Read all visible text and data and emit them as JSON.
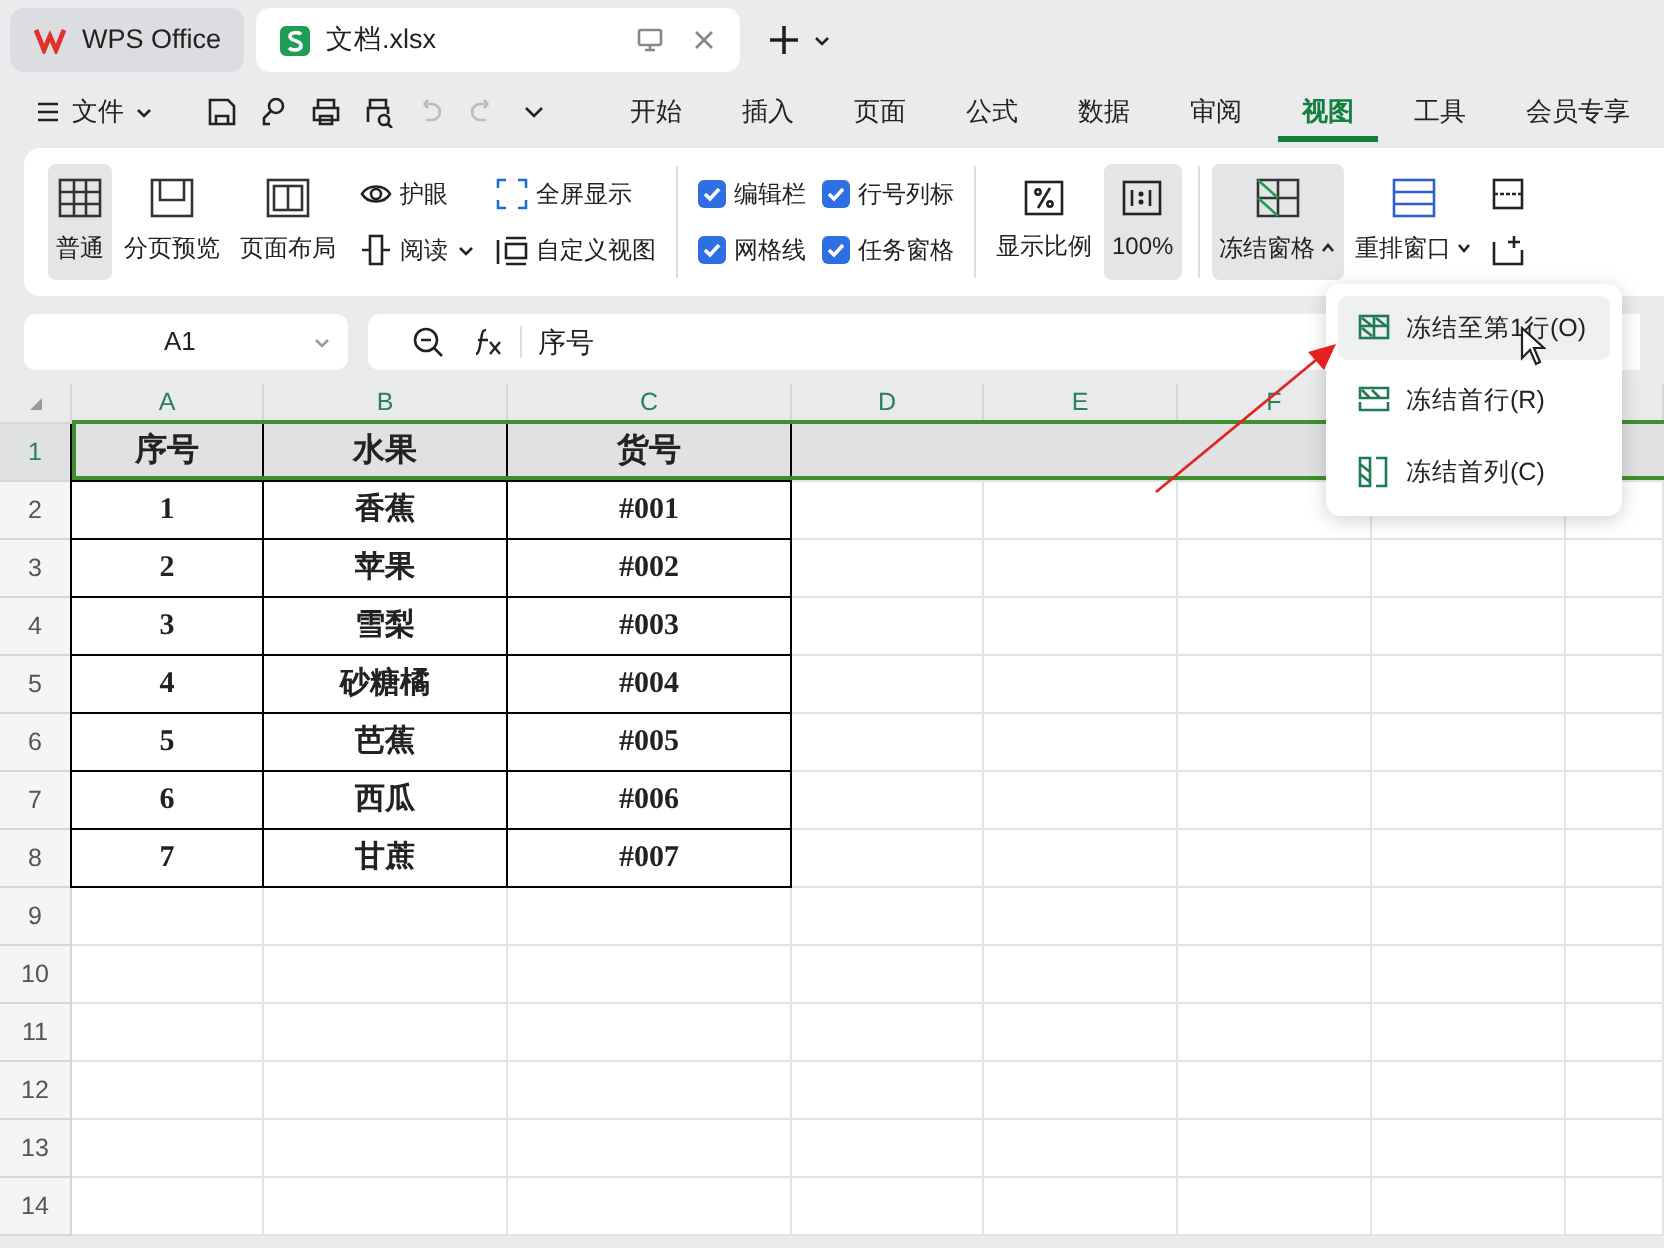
{
  "tabs": [
    {
      "label": "WPS Office",
      "selected": false
    },
    {
      "label": "文档.xlsx",
      "selected": true
    }
  ],
  "file_menu": "文件",
  "menu_tabs": [
    {
      "label": "开始",
      "selected": false
    },
    {
      "label": "插入",
      "selected": false
    },
    {
      "label": "页面",
      "selected": false
    },
    {
      "label": "公式",
      "selected": false
    },
    {
      "label": "数据",
      "selected": false
    },
    {
      "label": "审阅",
      "selected": false
    },
    {
      "label": "视图",
      "selected": true
    },
    {
      "label": "工具",
      "selected": false
    },
    {
      "label": "会员专享",
      "selected": false
    }
  ],
  "ribbon": {
    "view_buttons": [
      {
        "label": "普通",
        "selected": true
      },
      {
        "label": "分页预览",
        "selected": false
      },
      {
        "label": "页面布局",
        "selected": false
      }
    ],
    "small_buttons": [
      "护眼",
      "阅读",
      "全屏显示",
      "自定义视图"
    ],
    "checkboxes": [
      {
        "label": "编辑栏",
        "checked": true
      },
      {
        "label": "网格线",
        "checked": true
      },
      {
        "label": "行号列标",
        "checked": true
      },
      {
        "label": "任务窗格",
        "checked": true
      }
    ],
    "zoom_buttons": [
      {
        "label": "显示比例",
        "selected": false
      },
      {
        "label": "100%",
        "selected": true
      }
    ],
    "window_buttons": [
      {
        "label": "冻结窗格",
        "expanded": true
      },
      {
        "label": "重排窗口",
        "expanded": false
      }
    ]
  },
  "name_box": "A1",
  "formula": "序号",
  "sheet": {
    "columns": [
      "A",
      "B",
      "C",
      "D",
      "E",
      "F"
    ],
    "rows": [
      {
        "number": "1",
        "selected": true,
        "cells": [
          "序号",
          "水果",
          "货号"
        ]
      },
      {
        "number": "2",
        "selected": false,
        "cells": [
          "1",
          "香蕉",
          "#001"
        ]
      },
      {
        "number": "3",
        "selected": false,
        "cells": [
          "2",
          "苹果",
          "#002"
        ]
      },
      {
        "number": "4",
        "selected": false,
        "cells": [
          "3",
          "雪梨",
          "#003"
        ]
      },
      {
        "number": "5",
        "selected": false,
        "cells": [
          "4",
          "砂糖橘",
          "#004"
        ]
      },
      {
        "number": "6",
        "selected": false,
        "cells": [
          "5",
          "芭蕉",
          "#005"
        ]
      },
      {
        "number": "7",
        "selected": false,
        "cells": [
          "6",
          "西瓜",
          "#006"
        ]
      },
      {
        "number": "8",
        "selected": false,
        "cells": [
          "7",
          "甘蔗",
          "#007"
        ]
      },
      {
        "number": "9",
        "selected": false
      },
      {
        "number": "10",
        "selected": false
      },
      {
        "number": "11",
        "selected": false
      },
      {
        "number": "12",
        "selected": false
      },
      {
        "number": "13",
        "selected": false
      },
      {
        "number": "14",
        "selected": false
      }
    ]
  },
  "freeze_menu": [
    {
      "label": "冻结至第1行(O)",
      "selected": true
    },
    {
      "label": "冻结首行(R)",
      "selected": false
    },
    {
      "label": "冻结首列(C)",
      "selected": false
    }
  ]
}
